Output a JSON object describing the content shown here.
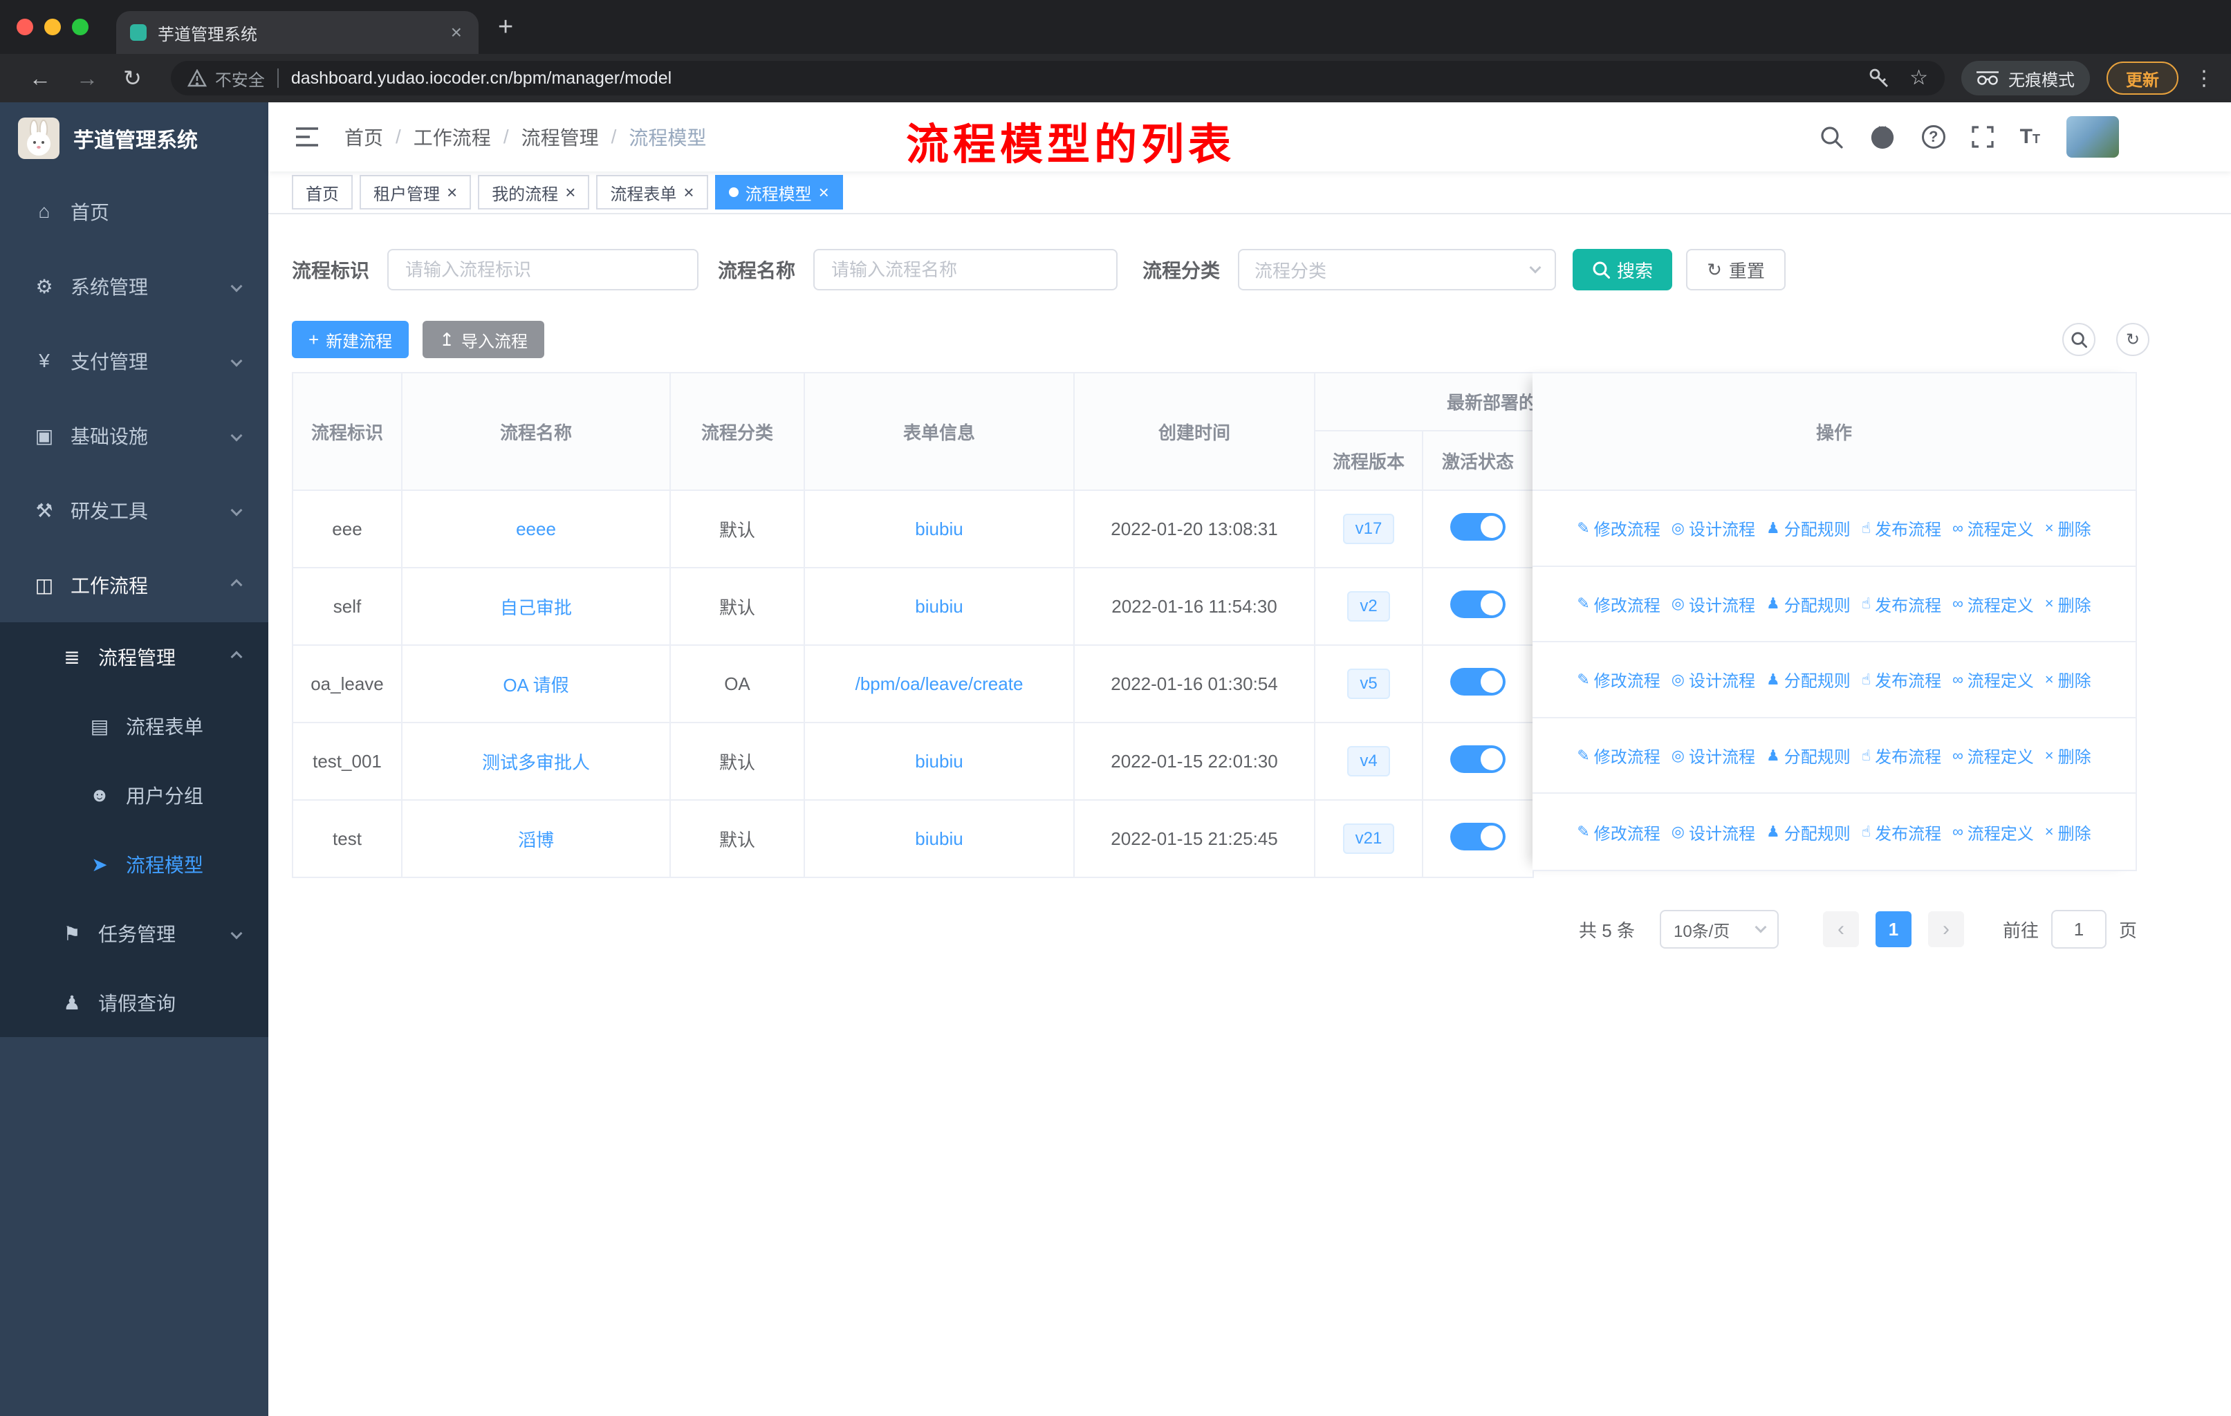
{
  "browser": {
    "tab_title": "芋道管理系统",
    "url": "dashboard.yudao.iocoder.cn/bpm/manager/model",
    "security_label": "不安全",
    "incognito_label": "无痕模式",
    "update_label": "更新"
  },
  "sidebar": {
    "logo_title": "芋道管理系统",
    "icon_glyphs": {
      "dashboard": "⌂",
      "gear": "⚙",
      "yen": "¥",
      "monitor": "▣",
      "tools": "⚒",
      "briefcase": "◫",
      "list": "≣",
      "form": "▤",
      "users": "☻",
      "plane": "➤",
      "flag": "⚑",
      "person": "♟"
    },
    "items": [
      {
        "id": "home",
        "label": "首页",
        "icon": "dashboard",
        "level": 1
      },
      {
        "id": "system",
        "label": "系统管理",
        "icon": "gear",
        "level": 1,
        "arrow": "down"
      },
      {
        "id": "payment",
        "label": "支付管理",
        "icon": "yen",
        "level": 1,
        "arrow": "down"
      },
      {
        "id": "infrastructure",
        "label": "基础设施",
        "icon": "monitor",
        "level": 1,
        "arrow": "down"
      },
      {
        "id": "devtools",
        "label": "研发工具",
        "icon": "tools",
        "level": 1,
        "arrow": "down"
      },
      {
        "id": "workflow",
        "label": "工作流程",
        "icon": "briefcase",
        "level": 1,
        "arrow": "up",
        "open": true
      },
      {
        "id": "process-management",
        "label": "流程管理",
        "icon": "list",
        "level": 2,
        "arrow": "up",
        "open": true,
        "submenu": true
      },
      {
        "id": "process-form",
        "label": "流程表单",
        "icon": "form",
        "level": 3,
        "submenu": true
      },
      {
        "id": "user-group",
        "label": "用户分组",
        "icon": "users",
        "level": 3,
        "submenu": true
      },
      {
        "id": "process-model",
        "label": "流程模型",
        "icon": "plane",
        "level": 3,
        "submenu": true,
        "active": true
      },
      {
        "id": "task-management",
        "label": "任务管理",
        "icon": "flag",
        "level": 2,
        "arrow": "down",
        "submenu": true
      },
      {
        "id": "leave-query",
        "label": "请假查询",
        "icon": "person",
        "level": 2,
        "submenu": true
      }
    ]
  },
  "header": {
    "breadcrumb": [
      "首页",
      "工作流程",
      "流程管理",
      "流程模型"
    ],
    "annotation": "流程模型的列表"
  },
  "tags": [
    {
      "id": "home",
      "label": "首页",
      "closable": false,
      "active": false
    },
    {
      "id": "tenant-management",
      "label": "租户管理",
      "closable": true,
      "active": false
    },
    {
      "id": "my-process",
      "label": "我的流程",
      "closable": true,
      "active": false
    },
    {
      "id": "process-form",
      "label": "流程表单",
      "closable": true,
      "active": false
    },
    {
      "id": "process-model",
      "label": "流程模型",
      "closable": true,
      "active": true
    }
  ],
  "filters": {
    "key_label": "流程标识",
    "key_placeholder": "请输入流程标识",
    "name_label": "流程名称",
    "name_placeholder": "请输入流程名称",
    "category_label": "流程分类",
    "category_placeholder": "流程分类",
    "search_label": "搜索",
    "reset_label": "重置"
  },
  "toolbar": {
    "create_label": "新建流程",
    "import_label": "导入流程"
  },
  "table": {
    "columns": [
      "流程标识",
      "流程名称",
      "流程分类",
      "表单信息",
      "创建时间"
    ],
    "group_header": "最新部署的",
    "sub_columns": [
      "流程版本",
      "激活状态"
    ],
    "ops_header": "操作",
    "row_actions": [
      "修改流程",
      "设计流程",
      "分配规则",
      "发布流程",
      "流程定义",
      "删除"
    ],
    "action_ids": [
      "edit-process",
      "design-process",
      "assign-rules",
      "publish-process",
      "process-definition",
      "delete-process"
    ],
    "action_glyphs": [
      "✎",
      "◎",
      "♟",
      "☝",
      "∞",
      "×"
    ],
    "rows": [
      {
        "key": "eee",
        "name": "eeee",
        "category": "默认",
        "form": "biubiu",
        "created": "2022-01-20 13:08:31",
        "version": "v17",
        "active": true
      },
      {
        "key": "self",
        "name": "自己审批",
        "category": "默认",
        "form": "biubiu",
        "created": "2022-01-16 11:54:30",
        "version": "v2",
        "active": true
      },
      {
        "key": "oa_leave",
        "name": "OA 请假",
        "category": "OA",
        "form": "/bpm/oa/leave/create",
        "created": "2022-01-16 01:30:54",
        "version": "v5",
        "active": true
      },
      {
        "key": "test_001",
        "name": "测试多审批人",
        "category": "默认",
        "form": "biubiu",
        "created": "2022-01-15 22:01:30",
        "version": "v4",
        "active": true
      },
      {
        "key": "test",
        "name": "滔博",
        "category": "默认",
        "form": "biubiu",
        "created": "2022-01-15 21:25:45",
        "version": "v21",
        "active": true
      }
    ]
  },
  "pagination": {
    "total_label": "共 5 条",
    "page_size": "10条/页",
    "current_page": "1",
    "goto_label": "前往",
    "goto_value": "1",
    "page_suffix": "页"
  },
  "colors": {
    "accent": "#409eff",
    "search_button": "#15b7a5",
    "annotation": "#fe0000",
    "sidebar_bg": "#304156",
    "sidebar_submenu_bg": "#1f2d3d"
  }
}
